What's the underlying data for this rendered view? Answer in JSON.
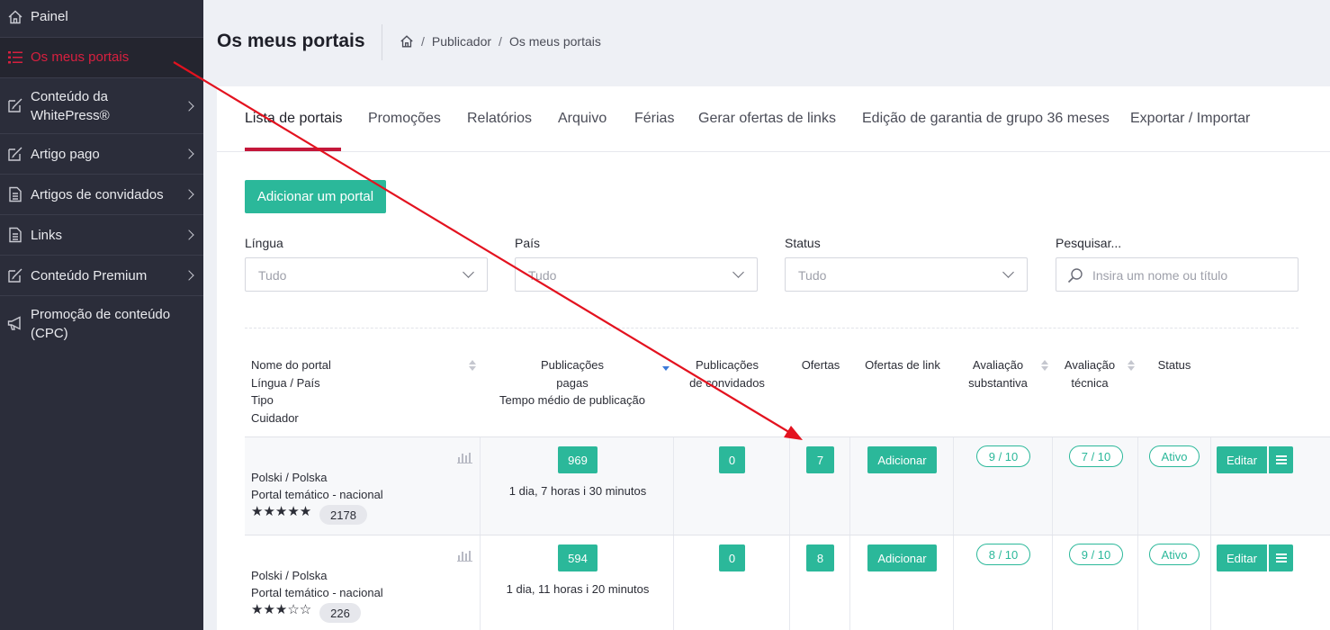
{
  "sidebar": {
    "items": [
      {
        "label": "Painel",
        "icon": "home-icon"
      },
      {
        "label": "Os meus portais",
        "icon": "list-icon",
        "active": true
      },
      {
        "label": "Conteúdo da WhitePress®",
        "icon": "edit-icon"
      },
      {
        "label": "Artigo pago",
        "icon": "edit-icon"
      },
      {
        "label": "Artigos de convidados",
        "icon": "document-icon"
      },
      {
        "label": "Links",
        "icon": "document-icon"
      },
      {
        "label": "Conteúdo Premium",
        "icon": "edit-icon"
      },
      {
        "label": "Promoção de conteúdo (CPC)",
        "icon": "megaphone-icon"
      }
    ]
  },
  "header": {
    "title": "Os meus portais",
    "breadcrumb": [
      "Publicador",
      "Os meus portais"
    ]
  },
  "tabs": [
    "Lista de portais",
    "Promoções",
    "Relatórios",
    "Arquivo",
    "Férias",
    "Gerar ofertas de links",
    "Edição de garantia de grupo 36 meses",
    "Exportar / Importar"
  ],
  "add_button": "Adicionar um portal",
  "filters": {
    "language": {
      "label": "Língua",
      "value": "Tudo"
    },
    "country": {
      "label": "País",
      "value": "Tudo"
    },
    "status": {
      "label": "Status",
      "value": "Tudo"
    },
    "search": {
      "label": "Pesquisar...",
      "placeholder": "Insira um nome ou título"
    }
  },
  "table": {
    "headers": {
      "name": [
        "Nome do portal",
        "Língua / País",
        "Tipo",
        "Cuidador"
      ],
      "paid": [
        "Publicações",
        "pagas",
        "Tempo médio de publicação"
      ],
      "guest": [
        "Publicações",
        "de convidados"
      ],
      "offers": "Ofertas",
      "link_offers": "Ofertas de link",
      "substantive": [
        "Avaliação",
        "substantiva"
      ],
      "technical": [
        "Avaliação",
        "técnica"
      ],
      "status": "Status"
    },
    "rows": [
      {
        "lang": "Polski / Polska",
        "type": "Portal temático - nacional",
        "stars": "★★★★★",
        "count": "2178",
        "paid": "969",
        "time": "1 dia, 7 horas i 30 minutos",
        "guest": "0",
        "offers": "7",
        "link_action": "Adicionar",
        "subst": "9 / 10",
        "tech": "7 / 10",
        "status": "Ativo",
        "edit": "Editar"
      },
      {
        "lang": "Polski / Polska",
        "type": "Portal temático - nacional",
        "stars": "★★★☆☆",
        "count": "226",
        "paid": "594",
        "time": "1 dia, 11 horas i 20 minutos",
        "guest": "0",
        "offers": "8",
        "link_action": "Adicionar",
        "subst": "8 / 10",
        "tech": "9 / 10",
        "status": "Ativo",
        "edit": "Editar"
      }
    ]
  },
  "colors": {
    "accent": "#2bb89a",
    "active": "#d8203f",
    "sidebar": "#2b2d3a",
    "annotation": "#e3121f"
  }
}
